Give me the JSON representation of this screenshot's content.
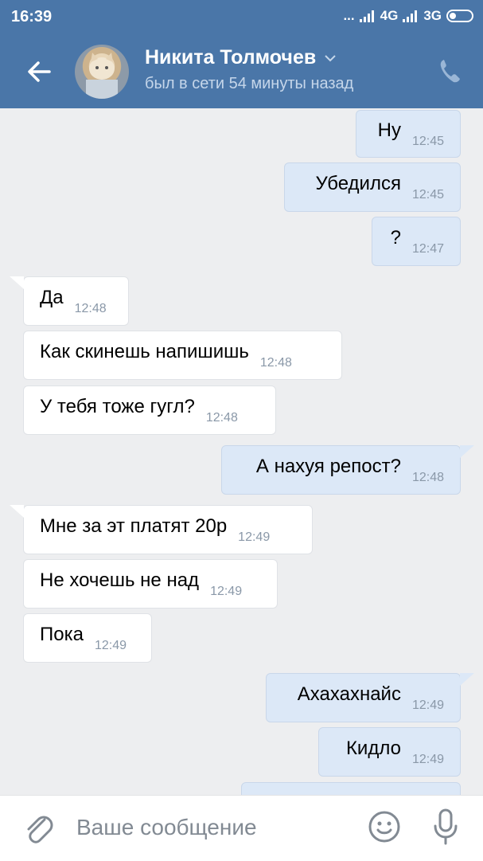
{
  "status": {
    "time": "16:39",
    "network_1": "4G",
    "network_2": "3G"
  },
  "header": {
    "name": "Никита Толмочев",
    "status": "был в сети 54 минуты назад",
    "accent": "#4a76a8"
  },
  "messages": [
    {
      "dir": "out",
      "text": "Ну",
      "time": "12:45"
    },
    {
      "dir": "out",
      "text": "Убедился",
      "time": "12:45"
    },
    {
      "dir": "out",
      "text": "?",
      "time": "12:47"
    },
    {
      "dir": "in",
      "text": "Да",
      "time": "12:48"
    },
    {
      "dir": "in",
      "text": "Как скинешь напишишь",
      "time": "12:48"
    },
    {
      "dir": "in",
      "text": "У тебя тоже гугл?",
      "time": "12:48"
    },
    {
      "dir": "out",
      "text": "А нахуя репост?",
      "time": "12:48"
    },
    {
      "dir": "in",
      "text": "Мне за эт платят 20р",
      "time": "12:49"
    },
    {
      "dir": "in",
      "text": "Не хочешь не над",
      "time": "12:49"
    },
    {
      "dir": "in",
      "text": "Пока",
      "time": "12:49"
    },
    {
      "dir": "out",
      "text": "Ахахахнайс",
      "time": "12:49"
    },
    {
      "dir": "out",
      "text": "Кидло",
      "time": "12:49"
    }
  ],
  "composer": {
    "placeholder": "Ваше сообщение"
  }
}
